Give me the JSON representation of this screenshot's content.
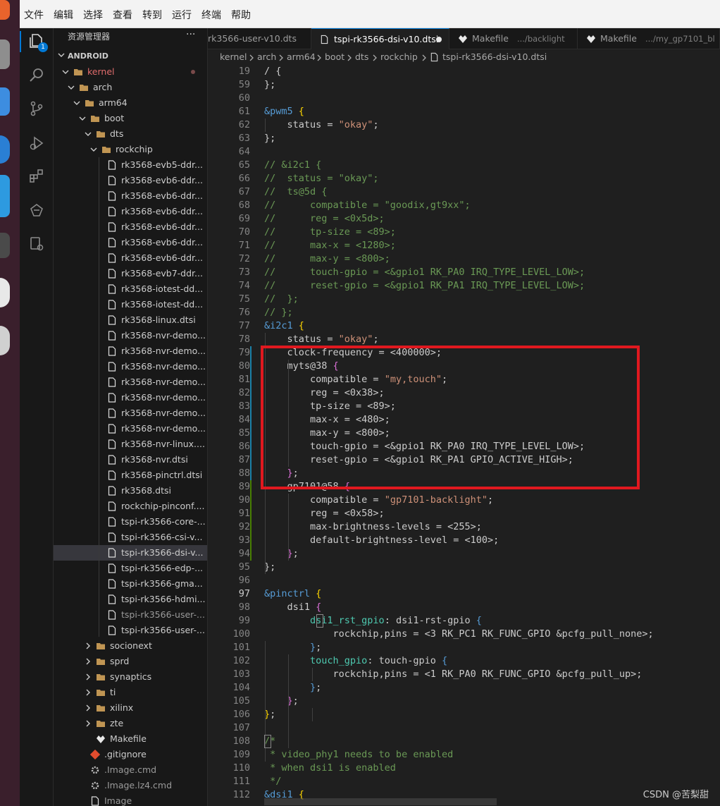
{
  "menubar": [
    "文件",
    "编辑",
    "选择",
    "查看",
    "转到",
    "运行",
    "终端",
    "帮助"
  ],
  "activity": [
    "files-icon",
    "search-icon",
    "source-control-icon",
    "run-debug-icon",
    "extensions-icon",
    "remote-icon",
    "test-icon"
  ],
  "activity_badge": "1",
  "explorer": {
    "title": "资源管理器",
    "more": "···",
    "root": "ANDROID",
    "items": [
      {
        "label": "kernel",
        "indent": 1,
        "type": "folder-open",
        "color": "#e06c6c",
        "dot": true
      },
      {
        "label": "arch",
        "indent": 2,
        "type": "folder-open"
      },
      {
        "label": "arm64",
        "indent": 3,
        "type": "folder-open"
      },
      {
        "label": "boot",
        "indent": 4,
        "type": "folder-open"
      },
      {
        "label": "dts",
        "indent": 5,
        "type": "folder-open"
      },
      {
        "label": "rockchip",
        "indent": 6,
        "type": "folder-open"
      },
      {
        "label": "rk3568-evb5-ddr...",
        "indent": 7,
        "type": "file"
      },
      {
        "label": "rk3568-evb6-ddr...",
        "indent": 7,
        "type": "file"
      },
      {
        "label": "rk3568-evb6-ddr...",
        "indent": 7,
        "type": "file"
      },
      {
        "label": "rk3568-evb6-ddr...",
        "indent": 7,
        "type": "file"
      },
      {
        "label": "rk3568-evb6-ddr...",
        "indent": 7,
        "type": "file"
      },
      {
        "label": "rk3568-evb6-ddr...",
        "indent": 7,
        "type": "file"
      },
      {
        "label": "rk3568-evb6-ddr...",
        "indent": 7,
        "type": "file"
      },
      {
        "label": "rk3568-evb7-ddr...",
        "indent": 7,
        "type": "file"
      },
      {
        "label": "rk3568-iotest-dd...",
        "indent": 7,
        "type": "file"
      },
      {
        "label": "rk3568-iotest-dd...",
        "indent": 7,
        "type": "file"
      },
      {
        "label": "rk3568-linux.dtsi",
        "indent": 7,
        "type": "file"
      },
      {
        "label": "rk3568-nvr-demo...",
        "indent": 7,
        "type": "file"
      },
      {
        "label": "rk3568-nvr-demo...",
        "indent": 7,
        "type": "file"
      },
      {
        "label": "rk3568-nvr-demo...",
        "indent": 7,
        "type": "file"
      },
      {
        "label": "rk3568-nvr-demo...",
        "indent": 7,
        "type": "file"
      },
      {
        "label": "rk3568-nvr-demo...",
        "indent": 7,
        "type": "file"
      },
      {
        "label": "rk3568-nvr-demo...",
        "indent": 7,
        "type": "file"
      },
      {
        "label": "rk3568-nvr-demo...",
        "indent": 7,
        "type": "file"
      },
      {
        "label": "rk3568-nvr-linux....",
        "indent": 7,
        "type": "file"
      },
      {
        "label": "rk3568-nvr.dtsi",
        "indent": 7,
        "type": "file"
      },
      {
        "label": "rk3568-pinctrl.dtsi",
        "indent": 7,
        "type": "file"
      },
      {
        "label": "rk3568.dtsi",
        "indent": 7,
        "type": "file"
      },
      {
        "label": "rockchip-pinconf....",
        "indent": 7,
        "type": "file"
      },
      {
        "label": "tspi-rk3566-core-...",
        "indent": 7,
        "type": "file"
      },
      {
        "label": "tspi-rk3566-csi-v...",
        "indent": 7,
        "type": "file"
      },
      {
        "label": "tspi-rk3566-dsi-v...",
        "indent": 7,
        "type": "file",
        "selected": true
      },
      {
        "label": "tspi-rk3566-edp-...",
        "indent": 7,
        "type": "file"
      },
      {
        "label": "tspi-rk3566-gma...",
        "indent": 7,
        "type": "file"
      },
      {
        "label": "tspi-rk3566-hdmi...",
        "indent": 7,
        "type": "file"
      },
      {
        "label": "tspi-rk3566-user-...",
        "indent": 7,
        "type": "file",
        "dim": true
      },
      {
        "label": "tspi-rk3566-user-...",
        "indent": 7,
        "type": "file"
      },
      {
        "label": "socionext",
        "indent": 5,
        "type": "folder"
      },
      {
        "label": "sprd",
        "indent": 5,
        "type": "folder"
      },
      {
        "label": "synaptics",
        "indent": 5,
        "type": "folder"
      },
      {
        "label": "ti",
        "indent": 5,
        "type": "folder"
      },
      {
        "label": "xilinx",
        "indent": 5,
        "type": "folder"
      },
      {
        "label": "zte",
        "indent": 5,
        "type": "folder"
      },
      {
        "label": "Makefile",
        "indent": 5,
        "type": "make"
      },
      {
        "label": ".gitignore",
        "indent": 4,
        "type": "git"
      },
      {
        "label": ".Image.cmd",
        "indent": 4,
        "type": "gear",
        "dim": true
      },
      {
        "label": ".Image.lz4.cmd",
        "indent": 4,
        "type": "gear",
        "dim": true
      },
      {
        "label": "Image",
        "indent": 4,
        "type": "file",
        "dim": true
      }
    ]
  },
  "tabs": [
    {
      "label": "rk3566-user-v10.dts",
      "active": false
    },
    {
      "label": "tspi-rk3566-dsi-v10.dtsi",
      "active": true,
      "dirty": true
    },
    {
      "label": "Makefile",
      "desc": ".../backlight",
      "active": false
    },
    {
      "label": "Makefile",
      "desc": ".../my_gp7101_bl",
      "active": false
    }
  ],
  "breadcrumb": [
    "kernel",
    "arch",
    "arm64",
    "boot",
    "dts",
    "rockchip",
    "tspi-rk3566-dsi-v10.dtsi"
  ],
  "code": [
    {
      "n": "19",
      "t": [
        [
          "/ {",
          "p"
        ]
      ]
    },
    {
      "n": "59",
      "t": [
        [
          "};",
          "p"
        ]
      ]
    },
    {
      "n": "60",
      "t": []
    },
    {
      "n": "61",
      "t": [
        [
          "&pwm5 ",
          "b"
        ],
        [
          "{",
          "y"
        ]
      ]
    },
    {
      "n": "62",
      "t": [
        [
          "    status = ",
          "p"
        ],
        [
          "\"okay\"",
          "s"
        ],
        [
          ";",
          "p"
        ]
      ]
    },
    {
      "n": "63",
      "t": [
        [
          "};",
          "p"
        ]
      ]
    },
    {
      "n": "64",
      "t": []
    },
    {
      "n": "65",
      "t": [
        [
          "// &i2c1 {",
          "c"
        ]
      ]
    },
    {
      "n": "66",
      "t": [
        [
          "//  status = \"okay\";",
          "c"
        ]
      ]
    },
    {
      "n": "67",
      "t": [
        [
          "//  ts@5d {",
          "c"
        ]
      ]
    },
    {
      "n": "68",
      "t": [
        [
          "//      compatible = \"goodix,gt9xx\";",
          "c"
        ]
      ]
    },
    {
      "n": "69",
      "t": [
        [
          "//      reg = <0x5d>;",
          "c"
        ]
      ]
    },
    {
      "n": "70",
      "t": [
        [
          "//      tp-size = <89>;",
          "c"
        ]
      ]
    },
    {
      "n": "71",
      "t": [
        [
          "//      max-x = <1280>;",
          "c"
        ]
      ]
    },
    {
      "n": "72",
      "t": [
        [
          "//      max-y = <800>;",
          "c"
        ]
      ]
    },
    {
      "n": "73",
      "t": [
        [
          "//      touch-gpio = <&gpio1 RK_PA0 IRQ_TYPE_LEVEL_LOW>;",
          "c"
        ]
      ]
    },
    {
      "n": "74",
      "t": [
        [
          "//      reset-gpio = <&gpio1 RK_PA1 IRQ_TYPE_LEVEL_LOW>;",
          "c"
        ]
      ]
    },
    {
      "n": "75",
      "t": [
        [
          "//  };",
          "c"
        ]
      ]
    },
    {
      "n": "76",
      "t": [
        [
          "// };",
          "c"
        ]
      ]
    },
    {
      "n": "77",
      "t": [
        [
          "&i2c1 ",
          "b"
        ],
        [
          "{",
          "y"
        ]
      ]
    },
    {
      "n": "78",
      "t": [
        [
          "    status = ",
          "p"
        ],
        [
          "\"okay\"",
          "s"
        ],
        [
          ";",
          "p"
        ]
      ]
    },
    {
      "n": "79",
      "t": [
        [
          "    clock-frequency = <400000>;",
          "p"
        ]
      ],
      "g": "b"
    },
    {
      "n": "80",
      "t": [
        [
          "    myts@38 ",
          "p"
        ],
        [
          "{",
          "m"
        ]
      ],
      "g": "b"
    },
    {
      "n": "81",
      "t": [
        [
          "        compatible = ",
          "p"
        ],
        [
          "\"my,touch\"",
          "s"
        ],
        [
          ";",
          "p"
        ]
      ],
      "g": "b"
    },
    {
      "n": "82",
      "t": [
        [
          "        reg = <0x38>;",
          "p"
        ]
      ],
      "g": "b"
    },
    {
      "n": "83",
      "t": [
        [
          "        tp-size = <89>;",
          "p"
        ]
      ],
      "g": "b"
    },
    {
      "n": "84",
      "t": [
        [
          "        max-x = <480>;",
          "p"
        ]
      ],
      "g": "b"
    },
    {
      "n": "85",
      "t": [
        [
          "        max-y = <800>;",
          "p"
        ]
      ],
      "g": "b"
    },
    {
      "n": "86",
      "t": [
        [
          "        touch-gpio = <&gpio1 RK_PA0 IRQ_TYPE_LEVEL_LOW>;",
          "p"
        ]
      ],
      "g": "b"
    },
    {
      "n": "87",
      "t": [
        [
          "        reset-gpio = <&gpio1 RK_PA1 GPIO_ACTIVE_HIGH>;",
          "p"
        ]
      ],
      "g": "b"
    },
    {
      "n": "88",
      "t": [
        [
          "    ",
          "p"
        ],
        [
          "}",
          "m"
        ],
        [
          ";",
          "p"
        ]
      ],
      "g": "b"
    },
    {
      "n": "89",
      "t": [
        [
          "    gp7101@58 ",
          "p"
        ],
        [
          "{",
          "m"
        ]
      ],
      "g": "g"
    },
    {
      "n": "90",
      "t": [
        [
          "        compatible = ",
          "p"
        ],
        [
          "\"gp7101-backlight\"",
          "s"
        ],
        [
          ";",
          "p"
        ]
      ],
      "g": "g"
    },
    {
      "n": "91",
      "t": [
        [
          "        reg = <0x58>;",
          "p"
        ]
      ],
      "g": "g"
    },
    {
      "n": "92",
      "t": [
        [
          "        max-brightness-levels = <255>;",
          "p"
        ]
      ],
      "g": "g"
    },
    {
      "n": "93",
      "t": [
        [
          "        default-brightness-level = <100>;",
          "p"
        ]
      ],
      "g": "g"
    },
    {
      "n": "94",
      "t": [
        [
          "    ",
          "p"
        ],
        [
          "}",
          "m"
        ],
        [
          ";",
          "p"
        ]
      ],
      "g": "g"
    },
    {
      "n": "95",
      "t": [
        [
          "};",
          "p"
        ]
      ]
    },
    {
      "n": "96",
      "t": []
    },
    {
      "n": "97",
      "t": [
        [
          "&pinctrl ",
          "b"
        ],
        [
          "{",
          "y"
        ]
      ],
      "cur": true
    },
    {
      "n": "98",
      "t": [
        [
          "    dsi1 ",
          "p"
        ],
        [
          "{",
          "m"
        ]
      ]
    },
    {
      "n": "99",
      "t": [
        [
          "        dsi1_rst_gpio",
          "g"
        ],
        [
          ": dsi1-rst-gpio ",
          "p"
        ],
        [
          "{",
          "b"
        ]
      ]
    },
    {
      "n": "100",
      "t": [
        [
          "            rockchip,pins = <3 RK_PC1 RK_FUNC_GPIO &pcfg_pull_none>;",
          "p"
        ]
      ]
    },
    {
      "n": "101",
      "t": [
        [
          "        ",
          "p"
        ],
        [
          "}",
          "b"
        ],
        [
          ";",
          "p"
        ]
      ]
    },
    {
      "n": "102",
      "t": [
        [
          "        touch_gpio",
          "g"
        ],
        [
          ": touch-gpio ",
          "p"
        ],
        [
          "{",
          "b"
        ]
      ]
    },
    {
      "n": "103",
      "t": [
        [
          "            rockchip,pins = <1 RK_PA0 RK_FUNC_GPIO &pcfg_pull_up>;",
          "p"
        ]
      ]
    },
    {
      "n": "104",
      "t": [
        [
          "        ",
          "p"
        ],
        [
          "}",
          "b"
        ],
        [
          ";",
          "p"
        ]
      ]
    },
    {
      "n": "105",
      "t": [
        [
          "    ",
          "p"
        ],
        [
          "}",
          "m"
        ],
        [
          ";",
          "p"
        ]
      ]
    },
    {
      "n": "106",
      "t": [
        [
          "}",
          "y"
        ],
        [
          ";",
          "p"
        ]
      ]
    },
    {
      "n": "107",
      "t": []
    },
    {
      "n": "108",
      "t": [
        [
          "/*",
          "c"
        ]
      ]
    },
    {
      "n": "109",
      "t": [
        [
          " * video_phy1 needs to be enabled",
          "c"
        ]
      ]
    },
    {
      "n": "110",
      "t": [
        [
          " * when dsi1 is enabled",
          "c"
        ]
      ]
    },
    {
      "n": "111",
      "t": [
        [
          " */",
          "c"
        ]
      ]
    },
    {
      "n": "112",
      "t": [
        [
          "&dsi1 ",
          "b"
        ],
        [
          "{",
          "y"
        ]
      ]
    }
  ],
  "watermark": "CSDN @苦梨甜",
  "colors": {
    "p": "#cccccc",
    "c": "#6a9955",
    "s": "#ce9178",
    "b": "#569cd6",
    "y": "#ffd700",
    "m": "#da70d6",
    "g": "#4ec9b0",
    "red": "#e0181f"
  }
}
